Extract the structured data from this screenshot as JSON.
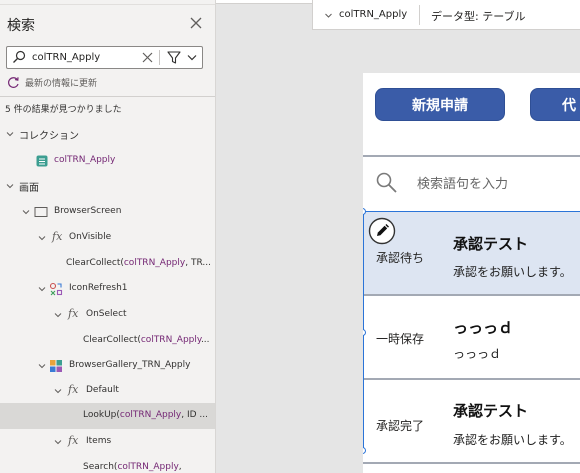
{
  "search_pane": {
    "title": "検索",
    "search_value": "colTRN_Apply",
    "refresh_label": "最新の情報に更新",
    "result_count": "5 件の結果が見つかりました",
    "tree": [
      {
        "depth": 0,
        "label": "コレクション"
      },
      {
        "depth": 1,
        "label_hl": "colTRN_Apply"
      },
      {
        "depth": 0,
        "label": "画面"
      },
      {
        "depth": 1,
        "label": "BrowserScreen"
      },
      {
        "depth": 2,
        "label": "OnVisible"
      },
      {
        "depth": 3,
        "pre": "ClearCollect(",
        "hl": "colTRN_Apply",
        "post": ", TR..."
      },
      {
        "depth": 2,
        "label": "IconRefresh1"
      },
      {
        "depth": 3,
        "label": "OnSelect"
      },
      {
        "depth": 4,
        "pre": "ClearCollect(",
        "hl": "colTRN_Apply",
        "post": "..."
      },
      {
        "depth": 2,
        "label": "BrowserGallery_TRN_Apply"
      },
      {
        "depth": 3,
        "label": "Default"
      },
      {
        "depth": 4,
        "pre": "LookUp(",
        "hl": "colTRN_Apply",
        "post": ", ID ..."
      },
      {
        "depth": 3,
        "label": "Items"
      },
      {
        "depth": 4,
        "pre": "Search(",
        "hl": "colTRN_Apply",
        "post": ","
      }
    ]
  },
  "top_bar": {
    "collection_name": "colTRN_Apply",
    "data_type": "データ型: テーブル"
  },
  "app": {
    "new_button": "新規申請",
    "proxy_button": "代",
    "search_placeholder": "検索語句を入力",
    "gallery": [
      {
        "status": "承認待ち",
        "title": "承認テスト",
        "subtitle": "承認をお願いします。"
      },
      {
        "status": "一時保存",
        "title": "っっっｄ",
        "subtitle": "っっっｄ"
      },
      {
        "status": "承認完了",
        "title": "承認テスト",
        "subtitle": "承認をお願いします。"
      }
    ]
  },
  "colors": {
    "button": "#3a5ca8",
    "selection": "#2b74d8",
    "highlight": "#742774",
    "selected_row": "#dde5f2"
  }
}
